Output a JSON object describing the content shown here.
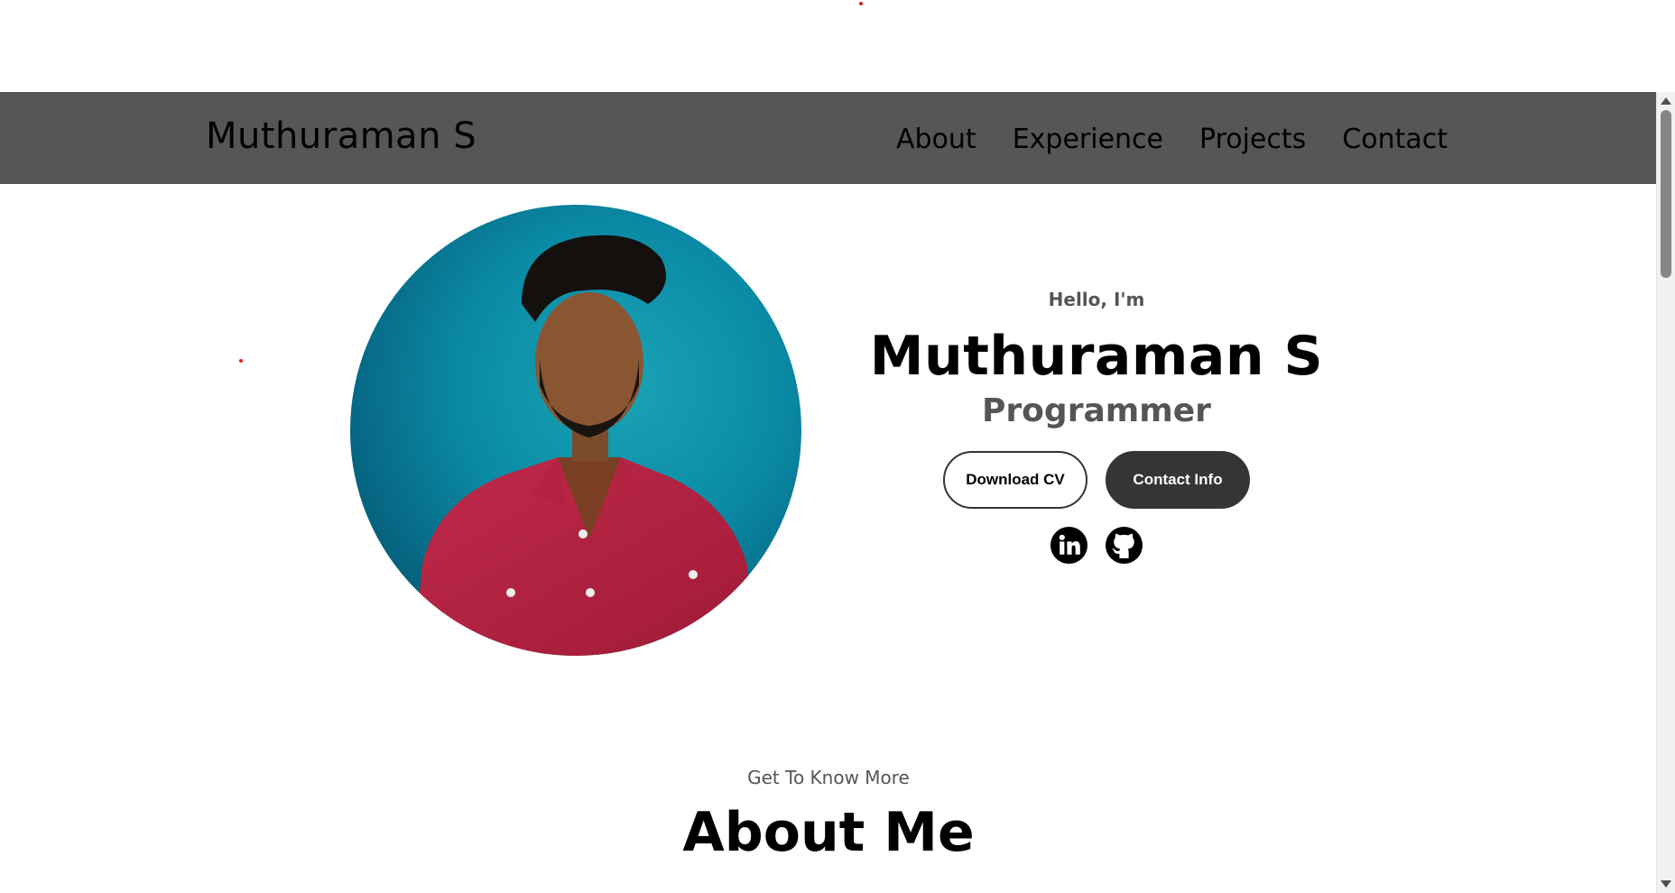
{
  "nav": {
    "brand": "Muthuraman S",
    "links": [
      "About",
      "Experience",
      "Projects",
      "Contact"
    ]
  },
  "hero": {
    "greeting": "Hello, I'm",
    "name": "Muthuraman S",
    "role": "Programmer",
    "buttons": {
      "download_cv": "Download CV",
      "contact_info": "Contact Info"
    },
    "socials": [
      "linkedin-icon",
      "github-icon"
    ]
  },
  "about": {
    "subtitle": "Get To Know More",
    "title": "About Me"
  },
  "colors": {
    "navbar_bg": "#575656",
    "button_dark": "#353535",
    "muted_text": "#555555",
    "accent_dot": "#d8211f"
  }
}
